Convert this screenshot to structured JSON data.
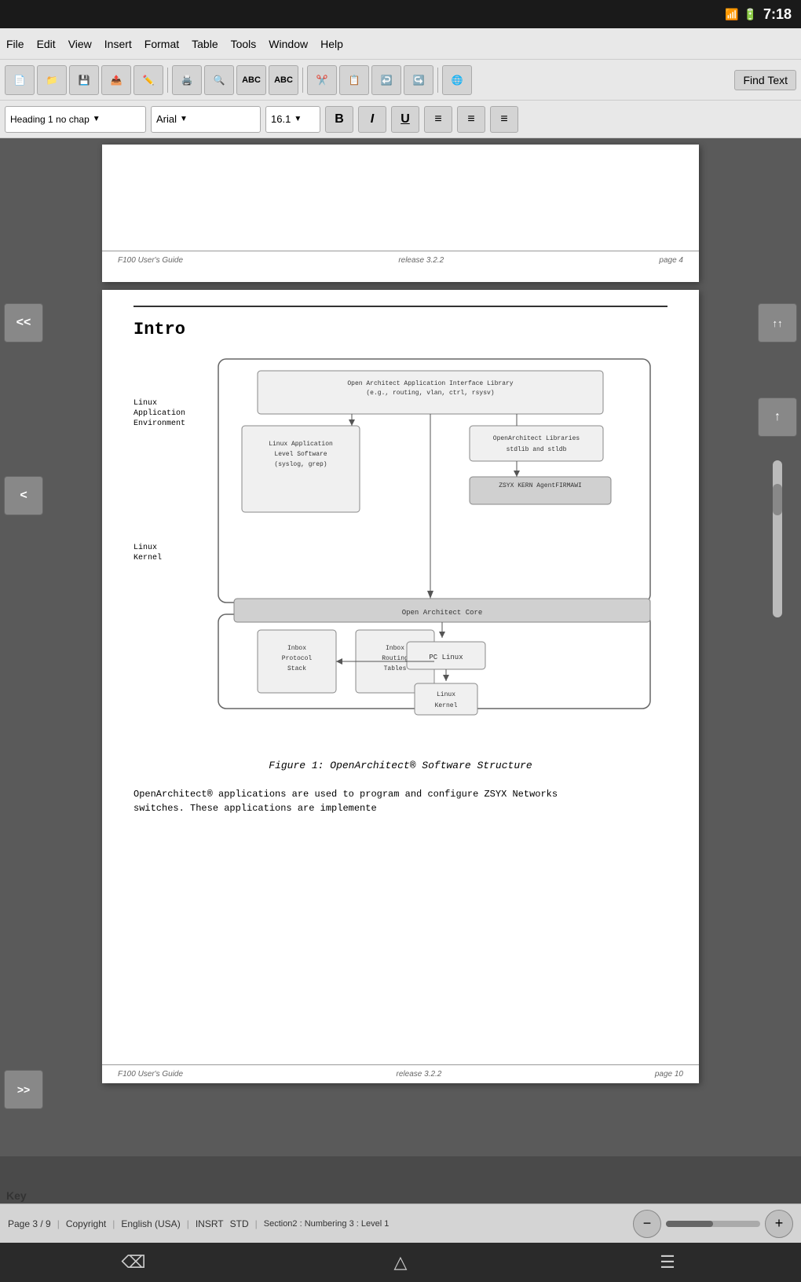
{
  "statusBar": {
    "time": "7:18",
    "batteryIcon": "🔋",
    "signalIcon": "📶"
  },
  "menuBar": {
    "items": [
      "File",
      "Edit",
      "View",
      "Insert",
      "Format",
      "Table",
      "Tools",
      "Window",
      "Help"
    ]
  },
  "toolbar": {
    "findText": "Find Text",
    "buttons": [
      "📄",
      "📁",
      "💾",
      "📤",
      "✏️",
      "🖨️",
      "🔍",
      "ABC",
      "ABC",
      "✂️",
      "📋",
      "↩️",
      "↪️",
      "🌐"
    ]
  },
  "formatBar": {
    "style": "Heading 1 no chap",
    "font": "Arial",
    "size": "16.1",
    "boldLabel": "B",
    "italicLabel": "I",
    "underlineLabel": "U",
    "alignLeft": "≡",
    "alignCenter": "≡",
    "alignRight": "≡"
  },
  "page1": {
    "footerLeft": "F100 User's Guide",
    "footerCenter": "release  3.2.2",
    "footerRight": "page 4"
  },
  "page2": {
    "sectionTitle": "Intro",
    "linuxAppEnvLabel": "Linux\nApplication\nEnvironment",
    "linuxKernelLabel": "Linux\nKernel",
    "diagramBoxes": {
      "openArchitectApp": "Open Architect Application Interface Library\n(e.g., routing, vlan, ctrl, rsysv)",
      "openArchitectLibs": "OpenArchitect Libraries\nstdlib and stldb",
      "zsyxKern": "ZSYX KERN AgentFIRMAWI",
      "linuxAppLevel": "Linux Application\nLevel Software\n(syslog, grep)",
      "inboxProtocol": "Inbox\nProtocol\nStack",
      "inboxRouting": "Inbox\nRouting\nTables",
      "openArchitectCore": "Open Architect Core",
      "pcLinux": "PC Linux",
      "linuxKernBox": "Linux\nKernel"
    },
    "figureCaption": "Figure 1: OpenArchitect® Software Structure",
    "bodyText": "OpenArchitect® applications are used to program and configure ZSYX Networks\nswitches. These applications are implemente",
    "footerLeft": "F100 User's Guide",
    "footerCenter": "release  3.2.2",
    "footerRight": "page 10"
  },
  "bottomStatus": {
    "page": "Page 3 / 9",
    "copyright": "Copyright",
    "language": "English (USA)",
    "insertMode": "INSRT",
    "mode": "STD",
    "section": "Section2 : Numbering 3 : Level 1"
  },
  "leftNav": {
    "backBtn": "<<",
    "prevBtn": "<"
  },
  "rightNav": {
    "upBtn": "↑↑",
    "upOneBtn": "↑"
  },
  "bottomNav": {
    "forwardBtn": ">>",
    "backIcon": "⌫",
    "homeIcon": "△",
    "menuIcon": "☰"
  },
  "keyLabel": "Key"
}
